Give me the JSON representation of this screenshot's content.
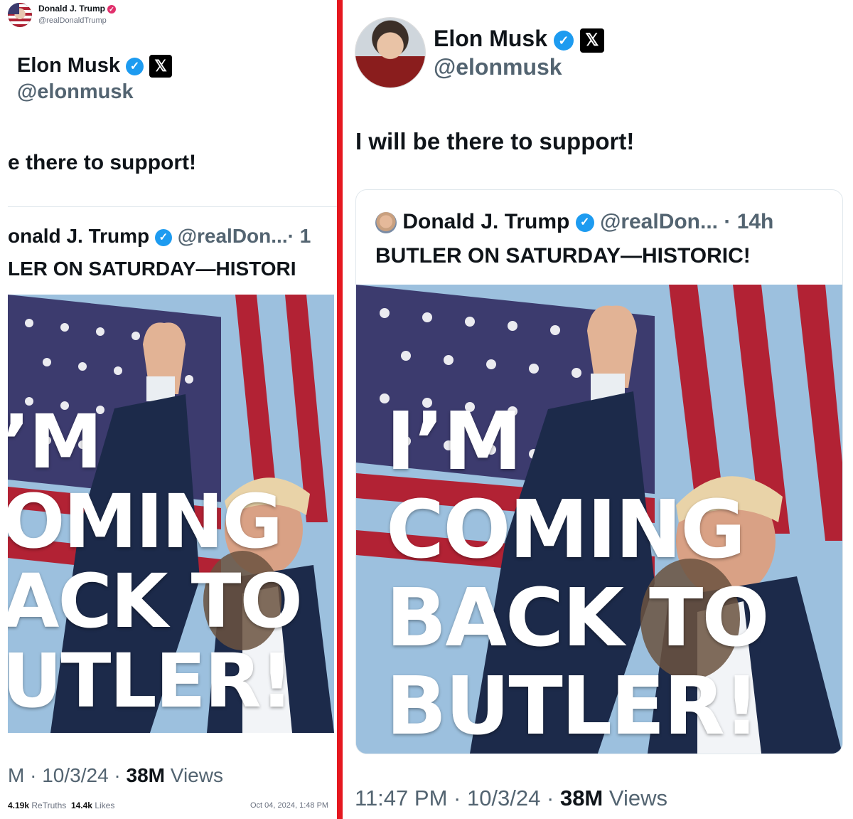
{
  "left_panel": {
    "truth_header": {
      "name": "Donald J. Trump",
      "handle": "@realDonaldTrump"
    },
    "author": {
      "name": "Elon Musk",
      "handle": "@elonmusk"
    },
    "post_text": "e there to support!",
    "quoted": {
      "name": "onald J. Trump",
      "handle": "@realDon...",
      "time_fragment": "· 1",
      "text": "LER ON SATURDAY—HISTORI"
    },
    "poster_lines": [
      "’M",
      "OMING",
      "ACK TO",
      "UTLER!"
    ],
    "timestamp": {
      "time": "M",
      "date": "10/3/24",
      "views_count": "38M",
      "views_label": "Views"
    },
    "stats": {
      "retruths_count": "4.19k",
      "retruths_label": "ReTruths",
      "likes_count": "14.4k",
      "likes_label": "Likes",
      "posted_at": "Oct 04, 2024, 1:48 PM"
    }
  },
  "right_panel": {
    "author": {
      "name": "Elon Musk",
      "handle": "@elonmusk"
    },
    "post_text": "I will be there to support!",
    "quoted": {
      "name": "Donald J. Trump",
      "handle": "@realDon...",
      "time": "14h",
      "text": "BUTLER ON SATURDAY—HISTORIC!"
    },
    "poster_lines": [
      "I’M",
      "COMING",
      "BACK TO",
      "BUTLER!"
    ],
    "timestamp": {
      "time": "11:47 PM",
      "date": "10/3/24",
      "views_count": "38M",
      "views_label": "Views"
    }
  },
  "icons": {
    "verified": "✓",
    "x_logo": "𝕏"
  },
  "colors": {
    "divider": "#e5171f",
    "verified_blue": "#1d9bf0",
    "flag_red": "#b22234",
    "flag_blue": "#3c3b6e"
  }
}
